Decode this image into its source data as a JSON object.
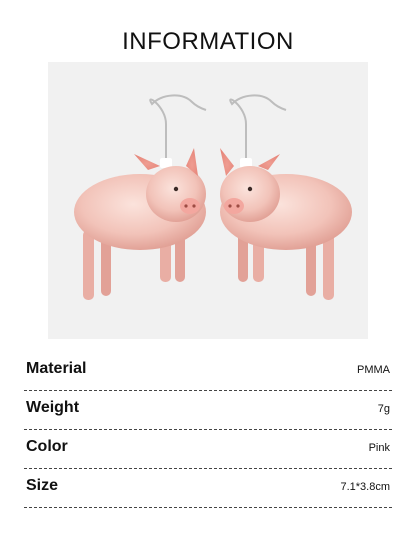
{
  "title": "INFORMATION",
  "product_image": {
    "subject": "pig-earrings",
    "background_color": "#f1f1f1",
    "pig_color": "#f2c3bb"
  },
  "specs": [
    {
      "label": "Material",
      "value": "PMMA"
    },
    {
      "label": "Weight",
      "value": "7g"
    },
    {
      "label": "Color",
      "value": "Pink"
    },
    {
      "label": "Size",
      "value": "7.1*3.8cm"
    }
  ]
}
